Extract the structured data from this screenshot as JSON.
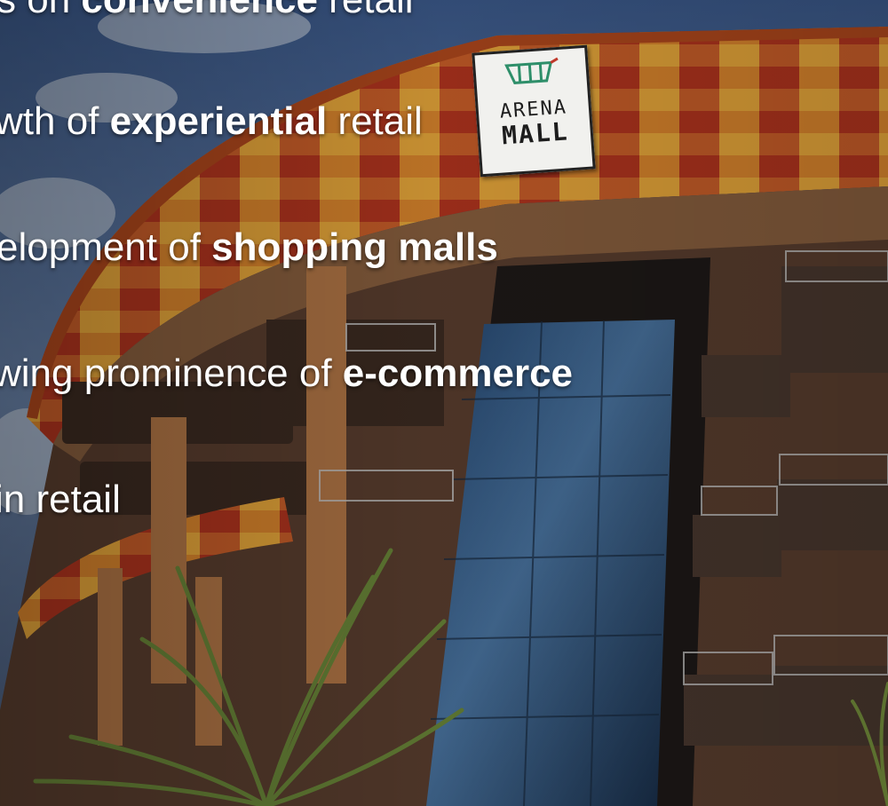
{
  "slide": {
    "lines": [
      {
        "lead": "s on ",
        "bold": "convenience",
        "trail": " retail"
      },
      {
        "lead": "wth of ",
        "bold": "experiential",
        "trail": " retail"
      },
      {
        "lead": "elopment of ",
        "bold": "shopping malls",
        "trail": ""
      },
      {
        "lead": "wing prominence of ",
        "bold": "e-commerce",
        "trail": ""
      },
      {
        "lead": " in retail",
        "bold": "",
        "trail": ""
      }
    ]
  },
  "sign": {
    "line1": "ARENA",
    "line2": "MALL",
    "icon": "cart-logo-icon"
  },
  "colors": {
    "sky": "#5a79a8",
    "facade_orange": "#e0872c",
    "facade_red": "#b3311f",
    "facade_yellow": "#f0b23e",
    "glass": "#2e4f78",
    "text": "#ffffff"
  }
}
